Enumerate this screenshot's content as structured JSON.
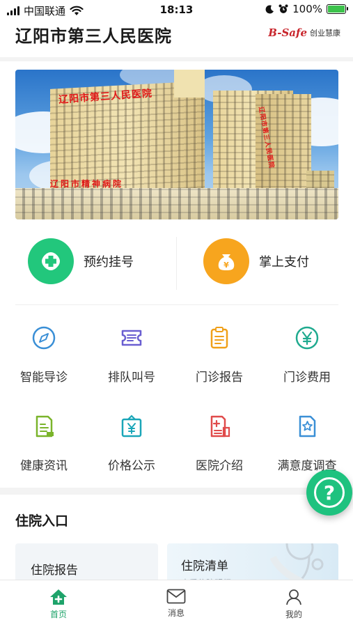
{
  "status_bar": {
    "carrier": "中国联通",
    "time": "18:13",
    "battery": "100%"
  },
  "header": {
    "title": "辽阳市第三人民医院",
    "brand_logo": "B-Safe",
    "brand_text": "创业慧康"
  },
  "banner": {
    "sign_main": "辽阳市第三人民医院",
    "sign_low": "辽阳市精神病院"
  },
  "quick_actions": [
    {
      "label": "预约挂号",
      "color": "#22c77c",
      "icon": "plus-icon"
    },
    {
      "label": "掌上支付",
      "color": "#f7a51e",
      "icon": "money-bag-icon"
    }
  ],
  "grid": [
    {
      "label": "智能导诊",
      "color": "#3a8fd6",
      "icon": "compass-icon"
    },
    {
      "label": "排队叫号",
      "color": "#6a5fd1",
      "icon": "ticket-icon"
    },
    {
      "label": "门诊报告",
      "color": "#f0a019",
      "icon": "clipboard-icon"
    },
    {
      "label": "门诊费用",
      "color": "#1faa8f",
      "icon": "yuan-icon"
    },
    {
      "label": "健康资讯",
      "color": "#7ab42b",
      "icon": "document-icon"
    },
    {
      "label": "价格公示",
      "color": "#1aa6b8",
      "icon": "price-board-icon"
    },
    {
      "label": "医院介绍",
      "color": "#e04b4b",
      "icon": "hospital-doc-icon"
    },
    {
      "label": "满意度调查",
      "color": "#3a8fd6",
      "icon": "star-doc-icon"
    }
  ],
  "inpatient": {
    "title": "住院入口",
    "cards": [
      {
        "title": "住院报告",
        "subtitle": ""
      },
      {
        "title": "住院清单",
        "subtitle": "查看住院明细"
      }
    ]
  },
  "help_button": "?",
  "tabbar": [
    {
      "label": "首页",
      "icon": "home-icon",
      "active": true
    },
    {
      "label": "消息",
      "icon": "mail-icon",
      "active": false
    },
    {
      "label": "我的",
      "icon": "user-icon",
      "active": false
    }
  ],
  "colors": {
    "accent": "#1ea36a",
    "help": "#1ec27f"
  }
}
